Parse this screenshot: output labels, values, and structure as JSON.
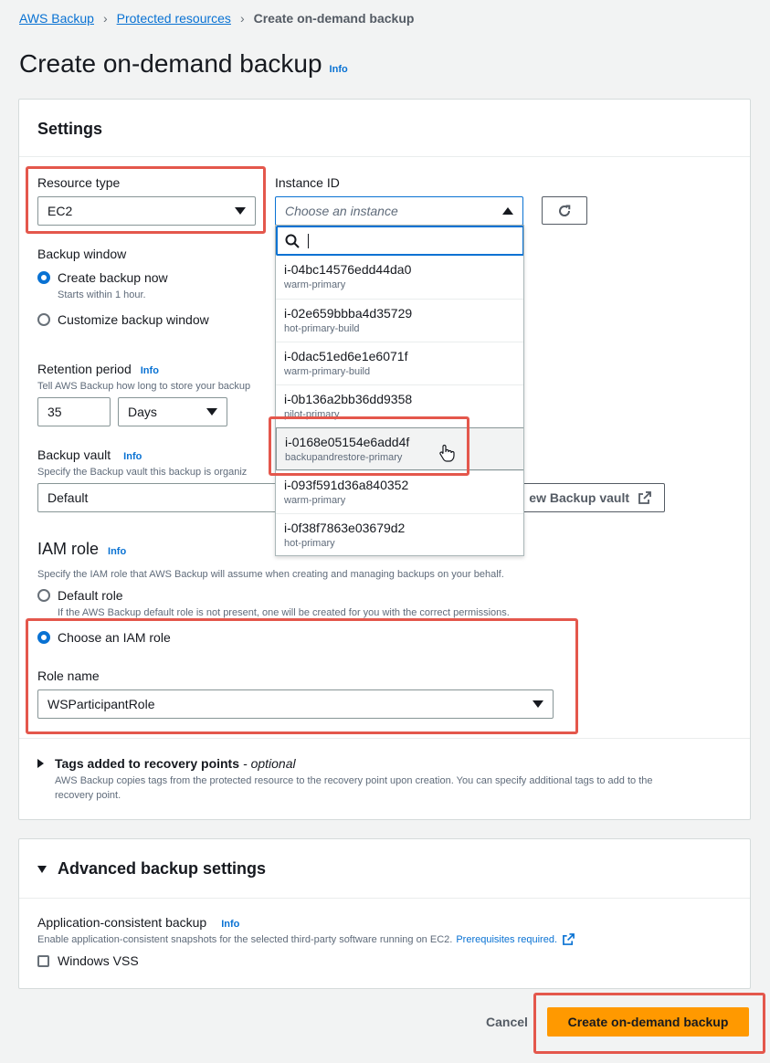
{
  "breadcrumb": {
    "items": [
      "AWS Backup",
      "Protected resources"
    ],
    "current": "Create on-demand backup"
  },
  "page_title": "Create on-demand backup",
  "info_label": "Info",
  "settings": {
    "title": "Settings",
    "resource_type": {
      "label": "Resource type",
      "value": "EC2"
    },
    "instance_id": {
      "label": "Instance ID",
      "placeholder": "Choose an instance"
    },
    "backup_window": {
      "label": "Backup window",
      "options": [
        {
          "label": "Create backup now",
          "description": "Starts within 1 hour.",
          "selected": true
        },
        {
          "label": "Customize backup window",
          "selected": false
        }
      ]
    },
    "retention": {
      "label": "Retention period",
      "description": "Tell AWS Backup how long to store your backup",
      "value": "35",
      "unit": "Days"
    },
    "vault": {
      "label": "Backup vault",
      "description": "Specify the Backup vault this backup is organiz",
      "value": "Default",
      "create_label": "ew Backup vault"
    },
    "iam": {
      "title": "IAM role",
      "description": "Specify the IAM role that AWS Backup will assume when creating and managing backups on your behalf.",
      "default_label": "Default role",
      "default_description": "If the AWS Backup default role is not present, one will be created for you with the correct permissions.",
      "choose_label": "Choose an IAM role",
      "role_name_label": "Role name",
      "role_name_value": "WSParticipantRole"
    },
    "tags": {
      "title": "Tags added to recovery points",
      "optional": "- optional",
      "description_1": "AWS Backup copies tags from the protected resource to the recovery point upon creation. You can specify additional tags to add to the",
      "description_2": "recovery point."
    }
  },
  "dropdown": {
    "items": [
      {
        "id": "i-04bc14576edd44da0",
        "tag": "warm-primary"
      },
      {
        "id": "i-02e659bbba4d35729",
        "tag": "hot-primary-build"
      },
      {
        "id": "i-0dac51ed6e1e6071f",
        "tag": "warm-primary-build"
      },
      {
        "id": "i-0b136a2bb36dd9358",
        "tag": "pilot-primary"
      },
      {
        "id": "i-0168e05154e6add4f",
        "tag": "backupandrestore-primary"
      },
      {
        "id": "i-093f591d36a840352",
        "tag": "warm-primary"
      },
      {
        "id": "i-0f38f7863e03679d2",
        "tag": "hot-primary"
      }
    ]
  },
  "advanced": {
    "title": "Advanced backup settings",
    "app_consistent_label": "Application-consistent backup",
    "app_consistent_description": "Enable application-consistent snapshots for the selected third-party software running on EC2.",
    "prereq_link": "Prerequisites required.",
    "vss_label": "Windows VSS"
  },
  "footer": {
    "cancel": "Cancel",
    "submit": "Create on-demand backup"
  },
  "colors": {
    "accent": "#0972d3",
    "primary_button": "#ff9900",
    "highlight": "#e4574c"
  }
}
